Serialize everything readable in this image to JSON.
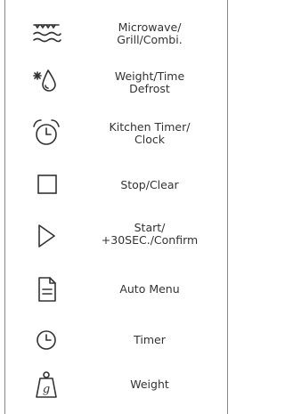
{
  "buttons": [
    {
      "icon": "microwave-grill-icon",
      "line1": "Microwave/",
      "line2": "Grill/Combi."
    },
    {
      "icon": "weight-time-defrost-icon",
      "line1": "Weight/Time",
      "line2": "Defrost"
    },
    {
      "icon": "alarm-clock-icon",
      "line1": "Kitchen Timer/",
      "line2": "Clock"
    },
    {
      "icon": "stop-square-icon",
      "line1": "Stop/Clear",
      "line2": ""
    },
    {
      "icon": "play-triangle-icon",
      "line1": "Start/",
      "line2": "+30SEC./Confirm"
    },
    {
      "icon": "document-icon",
      "line1": "Auto Menu",
      "line2": ""
    },
    {
      "icon": "clock-icon",
      "line1": "Timer",
      "line2": ""
    },
    {
      "icon": "weight-g-icon",
      "line1": "Weight",
      "line2": ""
    }
  ],
  "colors": {
    "stroke": "#333333",
    "text": "#333333",
    "border": "#888888"
  }
}
